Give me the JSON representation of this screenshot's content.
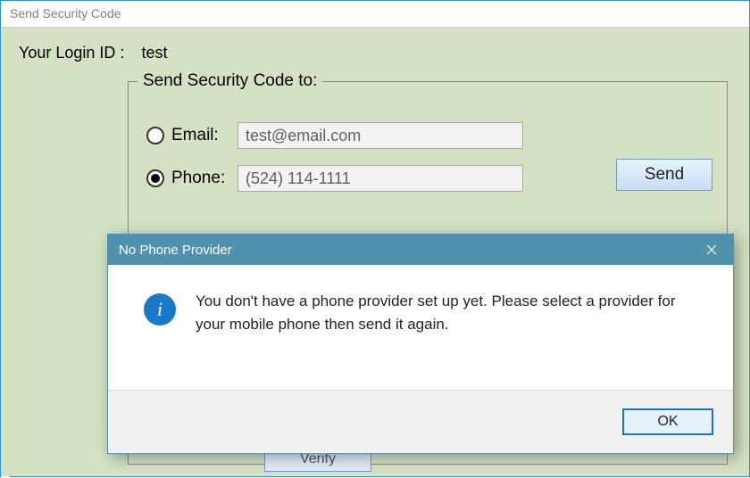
{
  "window": {
    "title": "Send Security Code"
  },
  "login": {
    "label": "Your Login ID :",
    "value": "test"
  },
  "group": {
    "legend": "Send Security Code to:",
    "email": {
      "label": "Email:",
      "value": "test@email.com",
      "selected": false
    },
    "phone": {
      "label": "Phone:",
      "value": "(524) 114-1111",
      "selected": true
    },
    "send_label": "Send",
    "verify_label": "Verify"
  },
  "dialog": {
    "title": "No Phone Provider",
    "message": "You don't have a phone provider set up yet. Please select a provider for your mobile phone then send it again.",
    "ok_label": "OK"
  }
}
